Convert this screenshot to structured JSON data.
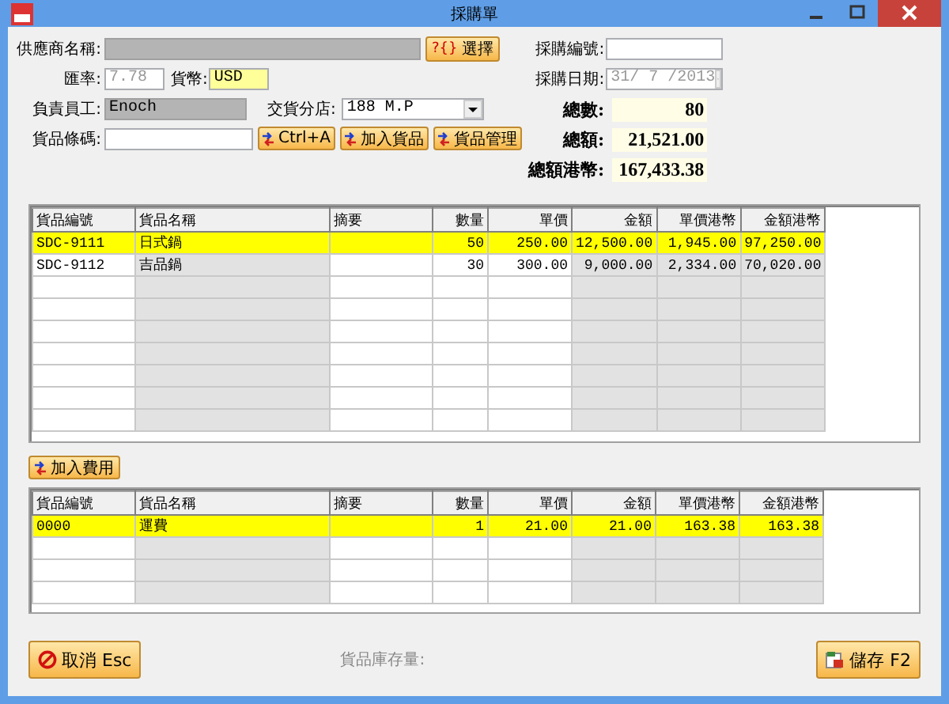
{
  "window": {
    "title": "採購單"
  },
  "form": {
    "supplier": {
      "label": "供應商名稱:",
      "value_disabled": true
    },
    "select_button": {
      "icon": "?{}",
      "label": "選擇"
    },
    "rate": {
      "label": "匯率:",
      "value": "7.78",
      "disabled": true
    },
    "currency": {
      "label": "貨幣:",
      "value": "USD"
    },
    "staff": {
      "label": "負責員工:",
      "value": "Enoch"
    },
    "branch": {
      "label": "交貨分店:",
      "value": "188 M.P"
    },
    "barcode": {
      "label": "貨品條碼:"
    },
    "buttons": [
      {
        "label": "Ctrl+A"
      },
      {
        "label": "加入貨品"
      },
      {
        "label": "貨品管理"
      }
    ],
    "po_number": {
      "label": "採購編號:"
    },
    "po_date": {
      "label": "採購日期:",
      "value": "31/ 7 /2013",
      "disabled": true
    }
  },
  "totals": [
    {
      "label": "總數:",
      "value": "80"
    },
    {
      "label": "總額:",
      "value": "21,521.00"
    },
    {
      "label": "總額港幣:",
      "value": "167,433.38"
    }
  ],
  "items_table": {
    "columns": [
      {
        "label": "貨品編號",
        "readonly": false
      },
      {
        "label": "貨品名稱",
        "readonly": true
      },
      {
        "label": "摘要",
        "readonly": false
      },
      {
        "label": "數量",
        "readonly": false
      },
      {
        "label": "單價",
        "readonly": false
      },
      {
        "label": "金額",
        "readonly": true
      },
      {
        "label": "單價港幣",
        "readonly": true
      },
      {
        "label": "金額港幣",
        "readonly": true
      }
    ],
    "rows": [
      {
        "selected": true,
        "cells": [
          "SDC-9111",
          "日式鍋",
          null,
          "50",
          "250.00",
          "12,500.00",
          "1,945.00",
          "97,250.00"
        ]
      },
      {
        "selected": false,
        "cells": [
          "SDC-9112",
          "吉品鍋",
          null,
          "30",
          "300.00",
          "9,000.00",
          "2,334.00",
          "70,020.00"
        ]
      }
    ]
  },
  "add_fee_button": {
    "label": "加入費用"
  },
  "fees_table": {
    "columns": [
      {
        "label": "貨品編號",
        "readonly": false
      },
      {
        "label": "貨品名稱",
        "readonly": true
      },
      {
        "label": "摘要",
        "readonly": false
      },
      {
        "label": "數量",
        "readonly": false
      },
      {
        "label": "單價",
        "readonly": false
      },
      {
        "label": "金額",
        "readonly": true
      },
      {
        "label": "單價港幣",
        "readonly": true
      },
      {
        "label": "金額港幣",
        "readonly": true
      }
    ],
    "rows": [
      {
        "selected": true,
        "cells": [
          "0000",
          "運費",
          null,
          "1",
          "21.00",
          "21.00",
          "163.38",
          "163.38"
        ]
      }
    ]
  },
  "cancel_button": {
    "label": "取消 Esc"
  },
  "stock_label": "貨品庫存量:",
  "save_button": {
    "label": "儲存 F2"
  }
}
